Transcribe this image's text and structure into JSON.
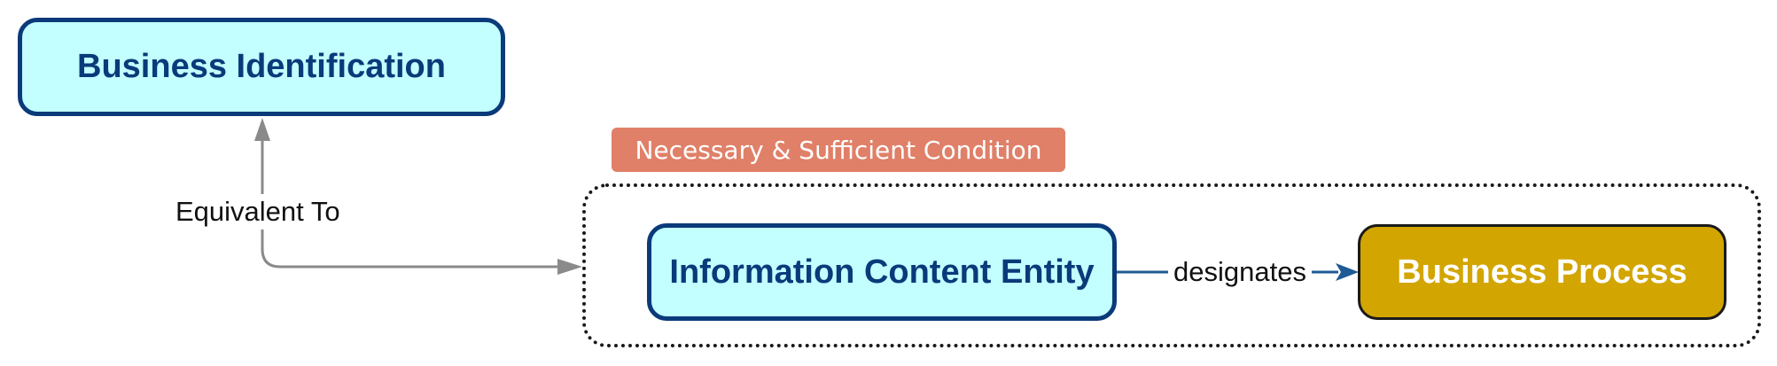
{
  "nodes": {
    "business_identification": "Business Identification",
    "information_content_entity": "Information Content Entity",
    "business_process": "Business Process"
  },
  "condition_tag": "Necessary & Sufficient Condition",
  "edges": {
    "equivalent_to": "Equivalent To",
    "designates": "designates"
  },
  "colors": {
    "class_fill": "#c3ffff",
    "class_border": "#0a3a7a",
    "process_fill": "#d2a500",
    "tag_fill": "#e08068",
    "equivalence_edge": "#8a8a8a",
    "relation_edge": "#1f5a95"
  }
}
